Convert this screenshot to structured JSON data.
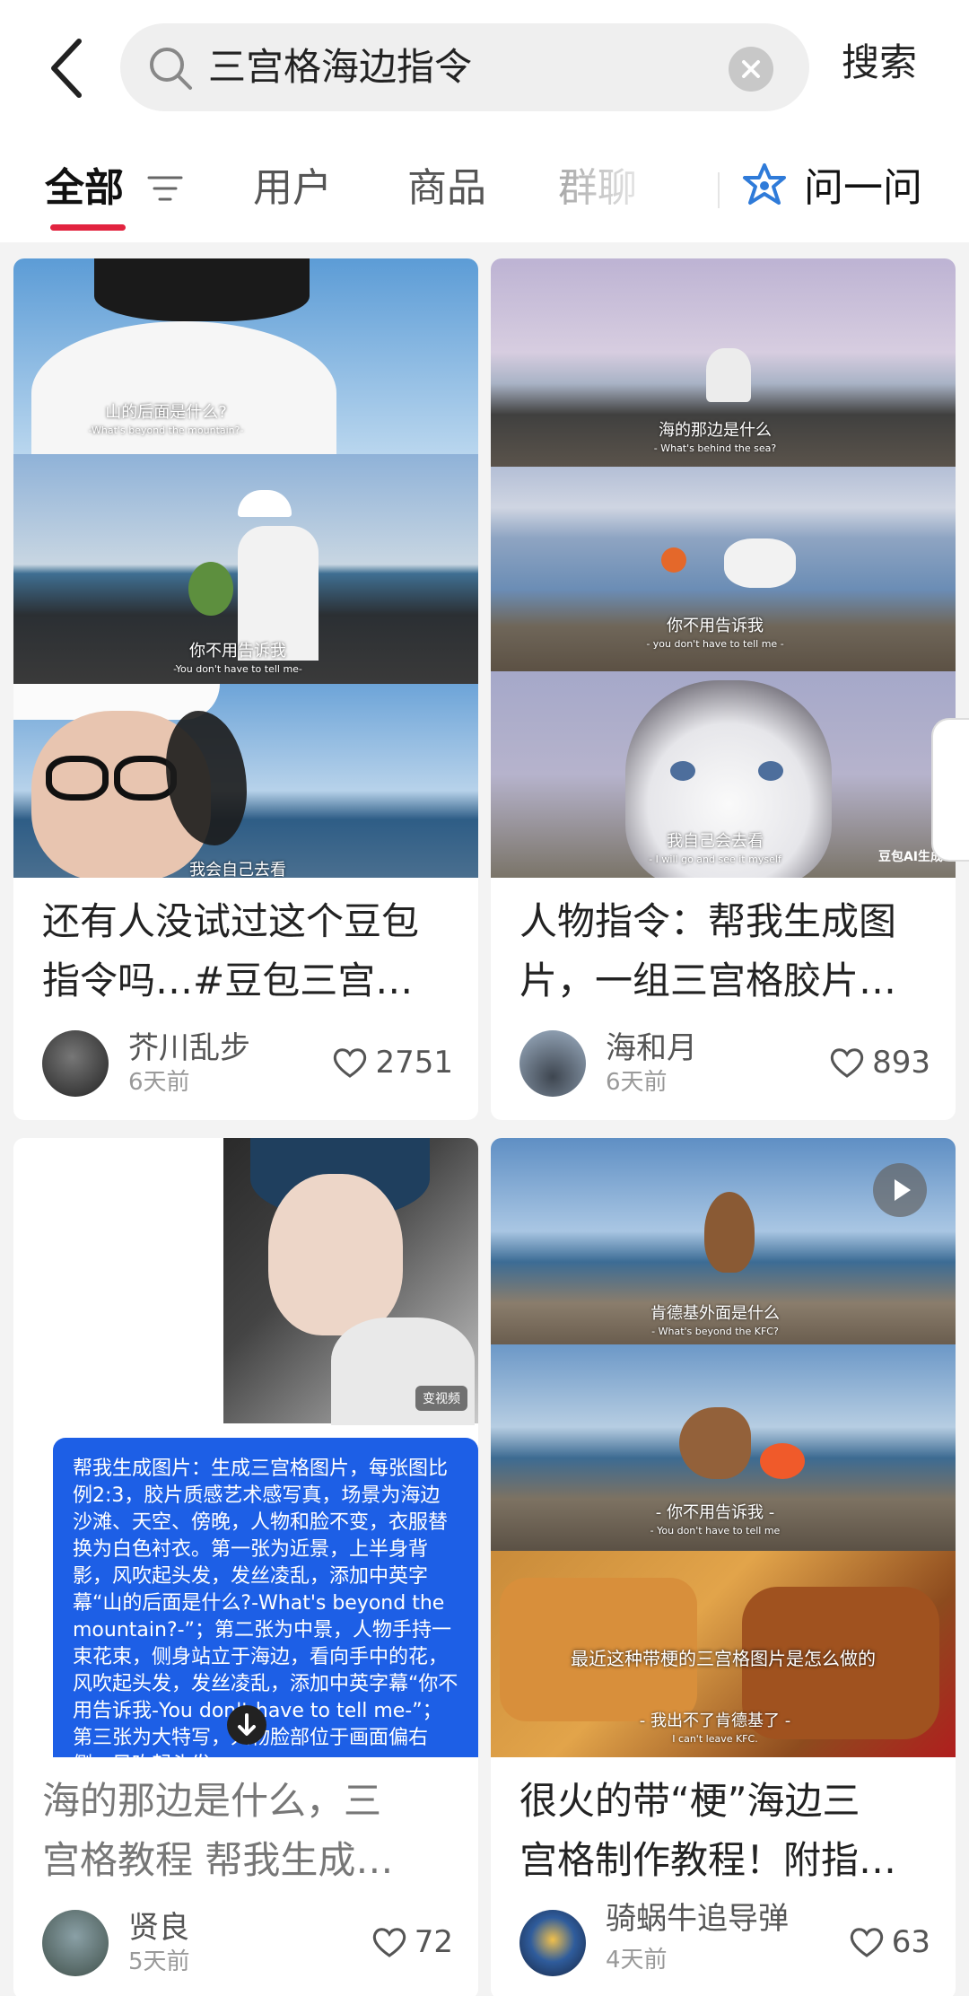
{
  "search": {
    "query": "三宫格海边指令",
    "button_label": "搜索"
  },
  "tabs": {
    "items": [
      "全部",
      "用户",
      "商品",
      "群聊"
    ],
    "ask_label": "问一问"
  },
  "accent_color": "#e2233f",
  "cards": [
    {
      "title_line1": "还有人没试过这个豆包",
      "title_line2": "指令吗…#豆包三宫…",
      "author": "芥川乱步",
      "time": "6天前",
      "likes": "2751",
      "captions": [
        {
          "zh": "山的后面是什么?",
          "en": "-What's beyond the mountain?-"
        },
        {
          "zh": "你不用告诉我",
          "en": "-You don't have to tell me-"
        },
        {
          "zh": "我会自己去看",
          "en": ""
        }
      ]
    },
    {
      "title_line1": "人物指令：帮我生成图",
      "title_line2": "片，一组三宫格胶片…",
      "author": "海和月",
      "time": "6天前",
      "likes": "893",
      "captions": [
        {
          "zh": "海的那边是什么",
          "en": "- What's behind the sea?"
        },
        {
          "zh": "你不用告诉我",
          "en": "- you don't have to tell me -"
        },
        {
          "zh": "我自己会去看",
          "en": "- I will go and see it myself"
        }
      ],
      "watermark": "豆包AI生成"
    },
    {
      "title_line1": "海的那边是什么，三",
      "title_line2": "宫格教程 帮我生成…",
      "author": "贤良",
      "time": "5天前",
      "likes": "72",
      "badge": "变视频",
      "prompt": "帮我生成图片：生成三宫格图片，每张图比例2:3，胶片质感艺术感写真，场景为海边沙滩、天空、傍晚，人物和脸不变，衣服替换为白色衬衣。第一张为近景，上半身背影，风吹起头发，发丝凌乱，添加中英字幕“山的后面是什么?-What's beyond the mountain?-”；第二张为中景，人物手持一束花束，侧身站立于海边，看向手中的花，风吹起头发，发丝凌乱，添加中英字幕“你不用告诉我-You don't have to tell me-”；第三张为大特写，人物脸部位于画面偏右侧，风吹起头发"
    },
    {
      "title_line1": "很火的带“梗”海边三",
      "title_line2": "宫格制作教程！附指…",
      "author": "骑蜗牛追导弹",
      "time": "4天前",
      "likes": "63",
      "captions": [
        {
          "zh": "肯德基外面是什么",
          "en": "- What's beyond the KFC?"
        },
        {
          "zh": "- 你不用告诉我 -",
          "en": "- You don't have to tell me"
        },
        {
          "zh": "- 我出不了肯德基了 -",
          "en": "I can't leave KFC."
        }
      ],
      "overlay_text": "最近这种带梗的三宫格图片是怎么做的"
    }
  ]
}
